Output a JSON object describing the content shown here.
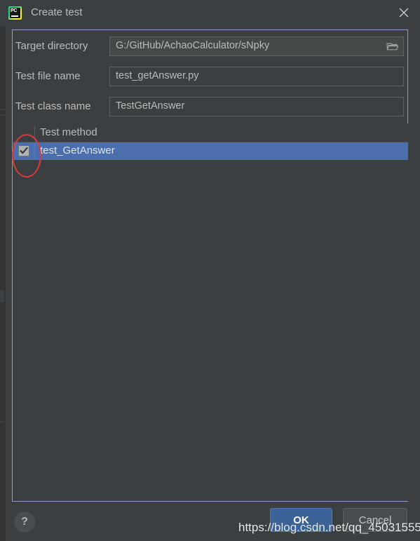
{
  "window": {
    "title": "Create test",
    "app_icon": "pycharm-icon",
    "icon_text": "PC",
    "close_icon": "close-icon"
  },
  "form": {
    "fields": [
      {
        "label": "Target directory",
        "value": "G:/GitHub/AchaoCalculator/sNpky",
        "has_browse": true,
        "browse_icon": "folder-icon"
      },
      {
        "label": "Test file name",
        "value": "test_getAnswer.py",
        "has_browse": false
      },
      {
        "label": "Test class name",
        "value": "TestGetAnswer",
        "has_browse": false
      }
    ]
  },
  "table": {
    "header": "Test method",
    "rows": [
      {
        "label": "test_GetAnswer",
        "checked": true,
        "selected": true
      }
    ]
  },
  "annotation": {
    "shape": "red-ellipse",
    "color": "#d93b3b",
    "target": "row-checkbox"
  },
  "footer": {
    "help_label": "?",
    "ok_label": "OK",
    "cancel_label": "Cancel"
  },
  "watermark": {
    "text": "https://blog.csdn.net/qq_45031555"
  },
  "colors": {
    "dialog_bg": "#3c3f41",
    "panel_border": "#8a9ec7",
    "selection_blue": "#4b6eaf",
    "ok_button": "#3c6398",
    "text": "#bbbbbb"
  }
}
